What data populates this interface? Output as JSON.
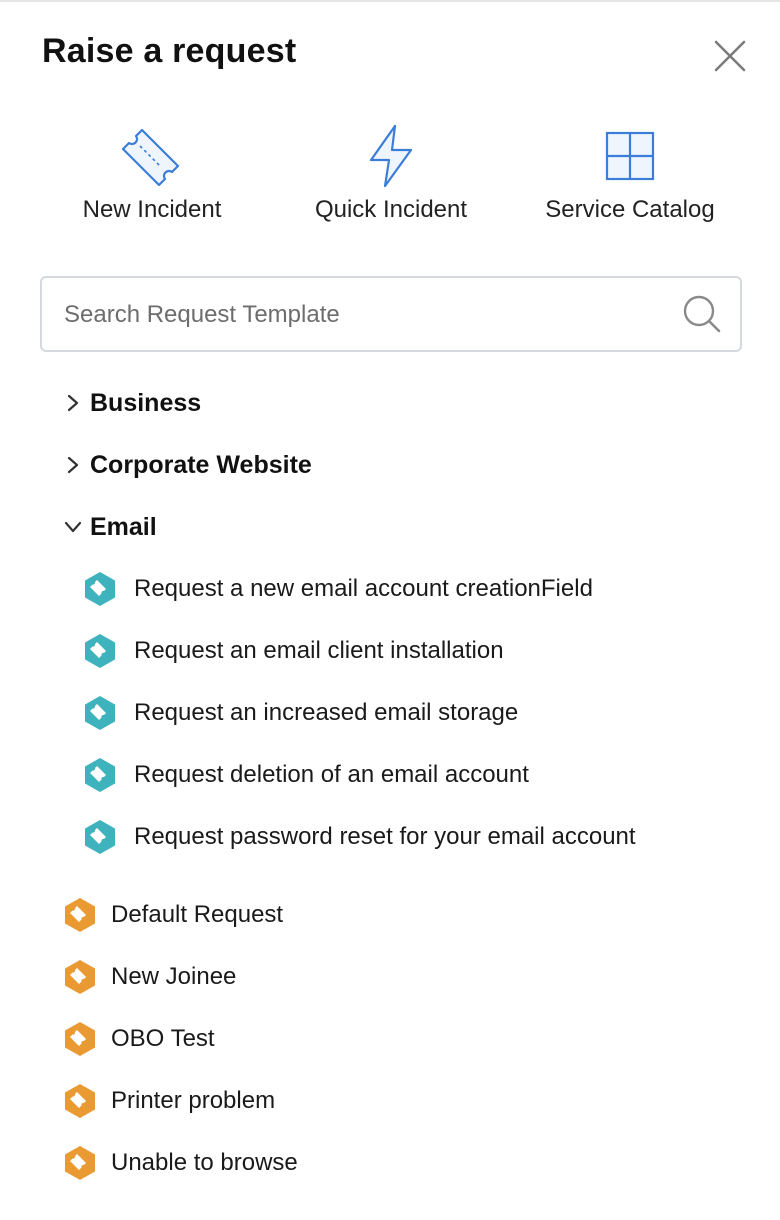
{
  "panel": {
    "title": "Raise a request"
  },
  "quick_actions": [
    {
      "label": "New Incident",
      "icon": "ticket-icon"
    },
    {
      "label": "Quick Incident",
      "icon": "lightning-icon"
    },
    {
      "label": "Service Catalog",
      "icon": "grid-icon"
    }
  ],
  "search": {
    "placeholder": "Search Request Template",
    "value": ""
  },
  "categories": [
    {
      "label": "Business",
      "expanded": false
    },
    {
      "label": "Corporate Website",
      "expanded": false
    },
    {
      "label": "Email",
      "expanded": true,
      "templates": [
        {
          "label": "Request a new email account creationField"
        },
        {
          "label": "Request an email client installation"
        },
        {
          "label": "Request an increased email storage"
        },
        {
          "label": "Request deletion of an email account"
        },
        {
          "label": "Request password reset for your email account"
        }
      ]
    }
  ],
  "uncategorized_templates": [
    {
      "label": "Default Request"
    },
    {
      "label": "New Joinee"
    },
    {
      "label": "OBO Test"
    },
    {
      "label": "Printer problem"
    },
    {
      "label": "Unable to browse"
    }
  ],
  "colors": {
    "accent_blue": "#3b7dd8",
    "teal_badge": "#3fb3bd",
    "orange_badge": "#e99a33",
    "border": "#d5d9dd"
  }
}
